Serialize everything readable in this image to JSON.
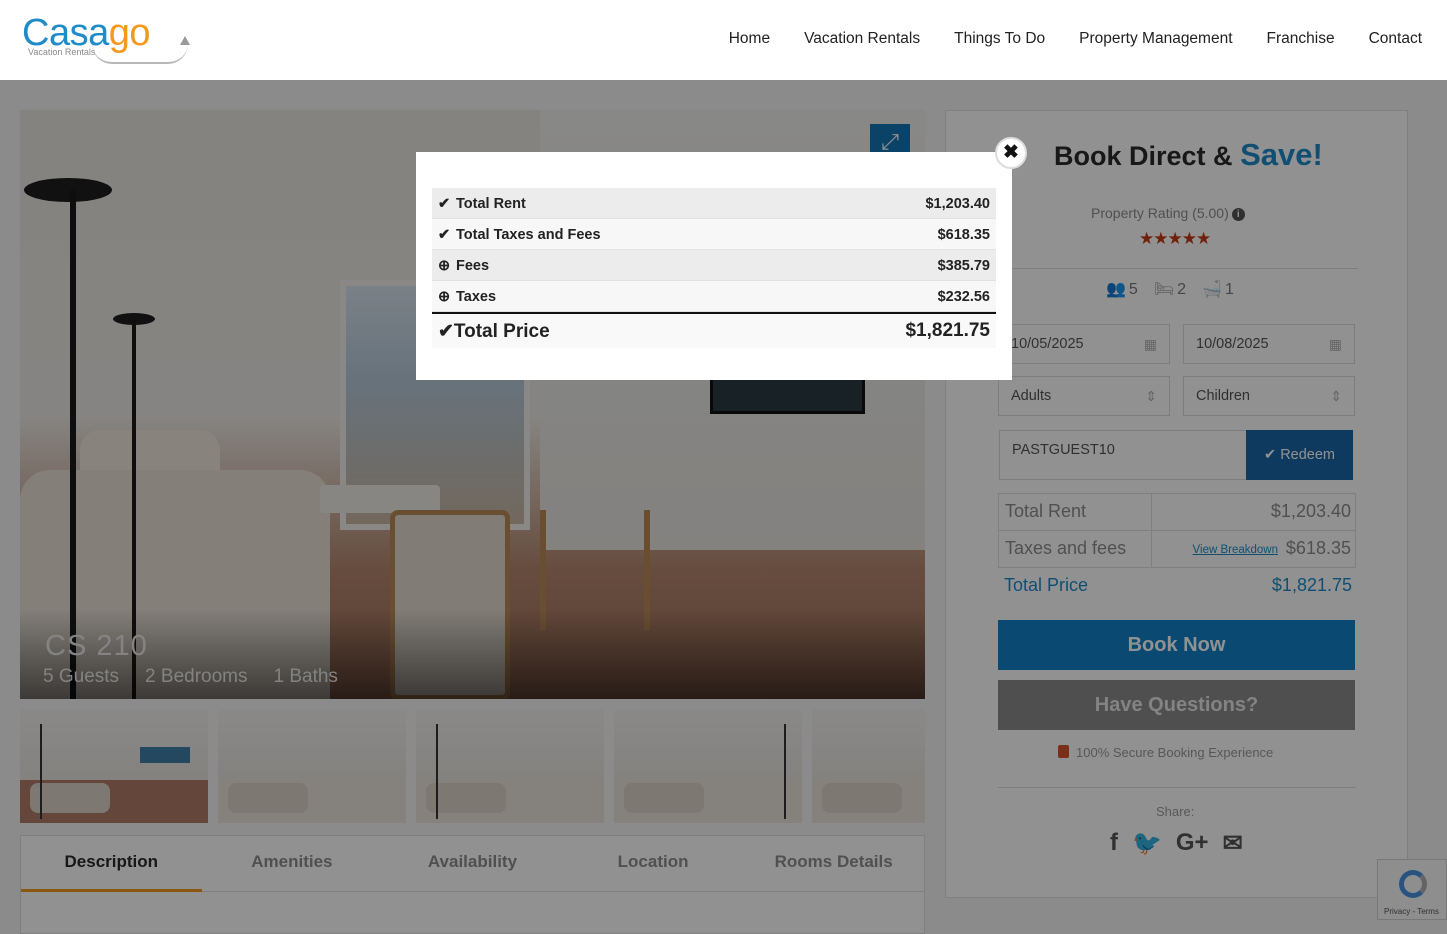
{
  "header": {
    "logo_text_a": "Casa",
    "logo_text_b": "go",
    "logo_sub": "Vacation Rentals",
    "nav": [
      "Home",
      "Vacation Rentals",
      "Things To Do",
      "Property Management",
      "Franchise",
      "Contact"
    ]
  },
  "property": {
    "title": "CS 210",
    "guests": "5 Guests",
    "bedrooms": "2 Bedrooms",
    "baths": "1 Baths"
  },
  "tabs": [
    "Description",
    "Amenities",
    "Availability",
    "Location",
    "Rooms Details"
  ],
  "sidebar": {
    "title_a": "Book Direct &",
    "title_b": "Save!",
    "rating": "Property Rating (5.00)",
    "stars": "★★★★★",
    "guests_count": "5",
    "bedrooms_count": "2",
    "baths_count": "1",
    "checkin": "10/05/2025",
    "checkout": "10/08/2025",
    "adults": "Adults",
    "children": "Children",
    "coupon": "PASTGUEST10",
    "redeem": "Redeem",
    "total_rent_label": "Total Rent",
    "total_rent_value": "$1,203.40",
    "taxes_label": "Taxes and fees",
    "view_breakdown": "View Breakdown",
    "taxes_value": "$618.35",
    "total_price_label": "Total Price",
    "total_price_value": "$1,821.75",
    "book_now": "Book Now",
    "questions": "Have Questions?",
    "secure": "100% Secure Booking Experience",
    "share": "Share:"
  },
  "recaptcha": {
    "text": "Privacy - Terms"
  },
  "modal": {
    "rows": [
      {
        "label": "Total Rent",
        "value": "$1,203.40"
      },
      {
        "label": "Total Taxes and Fees",
        "value": "$618.35"
      },
      {
        "label": "Fees",
        "value": "$385.79"
      },
      {
        "label": "Taxes",
        "value": "$232.56"
      }
    ],
    "total_label": "Total Price",
    "total_value": "$1,821.75"
  },
  "colors": {
    "brand_blue": "#1e8cc8",
    "brand_orange": "#f39a1e",
    "star_red": "#c23a14"
  }
}
